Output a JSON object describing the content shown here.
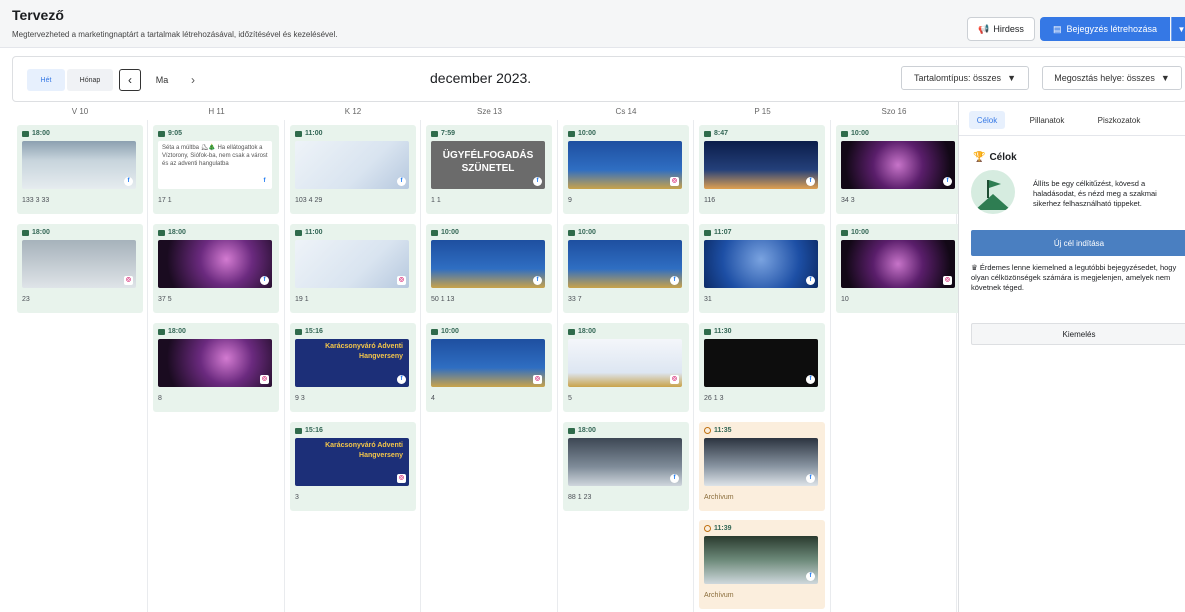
{
  "header": {
    "title": "Tervező",
    "subtitle": "Megtervezheted a marketingnaptárt a tartalmak létrehozásával, időzítésével és kezelésével.",
    "promote_label": "Hirdess",
    "create_label": "Bejegyzés létrehozása"
  },
  "toolbar": {
    "week_label": "Hét",
    "month_label": "Hónap",
    "today_label": "Ma",
    "month_title": "december 2023.",
    "filter_content": "Tartalomtípus: összes",
    "filter_placement": "Megosztás helye: összes"
  },
  "days": [
    "V 10",
    "H 11",
    "K 12",
    "Sze 13",
    "Cs 14",
    "P 15",
    "Szo 16"
  ],
  "columns": [
    [
      {
        "time": "18:00",
        "img": "child-snow",
        "net": "fb",
        "stats": "133  3  33"
      },
      {
        "time": "18:00",
        "img": "child-snow2",
        "net": "ig",
        "stats": "23"
      }
    ],
    [
      {
        "time": "9:05",
        "img": "text",
        "net": "fb",
        "stats": "17  1",
        "text": "Séta a múltba ⛸🎄 Ha ellátogattok a Víztorony, Siófok-ba, nem csak a várost és az adventi hangulatba"
      },
      {
        "time": "18:00",
        "img": "aerial",
        "net": "fb",
        "stats": "37  5"
      },
      {
        "time": "18:00",
        "img": "aerial",
        "net": "ig",
        "stats": "8"
      }
    ],
    [
      {
        "time": "11:00",
        "img": "poster-light",
        "net": "fb",
        "stats": "103  4  29"
      },
      {
        "time": "11:00",
        "img": "poster-light",
        "net": "ig",
        "stats": "19  1"
      },
      {
        "time": "15:16",
        "img": "concert",
        "net": "fb",
        "stats": "9  3",
        "text": "Karácsonyváró Adventi Hangverseny"
      },
      {
        "time": "15:16",
        "img": "concert",
        "net": "ig",
        "stats": "3",
        "text": "Karácsonyváró Adventi Hangverseny"
      }
    ],
    [
      {
        "time": "7:59",
        "img": "closed",
        "net": "fb",
        "stats": "1  1",
        "text": "ÜGYFÉLFOGADÁS SZÜNETEL"
      },
      {
        "time": "10:00",
        "img": "poster-blue",
        "net": "fb",
        "stats": "50  1  13"
      },
      {
        "time": "10:00",
        "img": "poster-blue",
        "net": "ig",
        "stats": "4"
      }
    ],
    [
      {
        "time": "10:00",
        "img": "poster-blue",
        "net": "ig",
        "stats": "9"
      },
      {
        "time": "10:00",
        "img": "poster-blue",
        "net": "fb",
        "stats": "33  7"
      },
      {
        "time": "18:00",
        "img": "poster-white",
        "net": "ig",
        "stats": "5"
      },
      {
        "time": "18:00",
        "img": "rink",
        "net": "fb",
        "stats": "88  1  23"
      }
    ],
    [
      {
        "time": "8:47",
        "img": "tower",
        "net": "fb",
        "stats": "116"
      },
      {
        "time": "11:07",
        "img": "ornament",
        "net": "fb",
        "stats": "31"
      },
      {
        "time": "11:30",
        "img": "dark",
        "net": "fb",
        "stats": "26  1  3"
      },
      {
        "time": "11:35",
        "img": "rink2",
        "net": "fb",
        "arch": true,
        "label": "Archívum"
      },
      {
        "time": "11:39",
        "img": "mascot",
        "net": "fb",
        "arch": true,
        "label": "Archívum"
      }
    ],
    [
      {
        "time": "10:00",
        "img": "fire",
        "net": "fb",
        "stats": "34  3"
      },
      {
        "time": "10:00",
        "img": "fire",
        "net": "ig",
        "stats": "10"
      }
    ]
  ],
  "sidebar": {
    "tabs": [
      "Célok",
      "Pillanatok",
      "Piszkozatok"
    ],
    "goals_title": "Célok",
    "goals_text": "Állíts be egy célkitűzést, kövesd a haladásodat, és nézd meg a szakmai sikerhez felhasználható tippeket.",
    "new_goal_label": "Új cél indítása",
    "tip_text": "Érdemes lenne kiemelned a legutóbbi bejegyzésedet, hogy olyan célközönségek számára is megjelenjen, amelyek nem követnek téged.",
    "highlight_label": "Kiemelés"
  },
  "colors": {
    "accent": "#3578e5",
    "card": "#e8f3ec",
    "archive": "#fbeedd"
  }
}
